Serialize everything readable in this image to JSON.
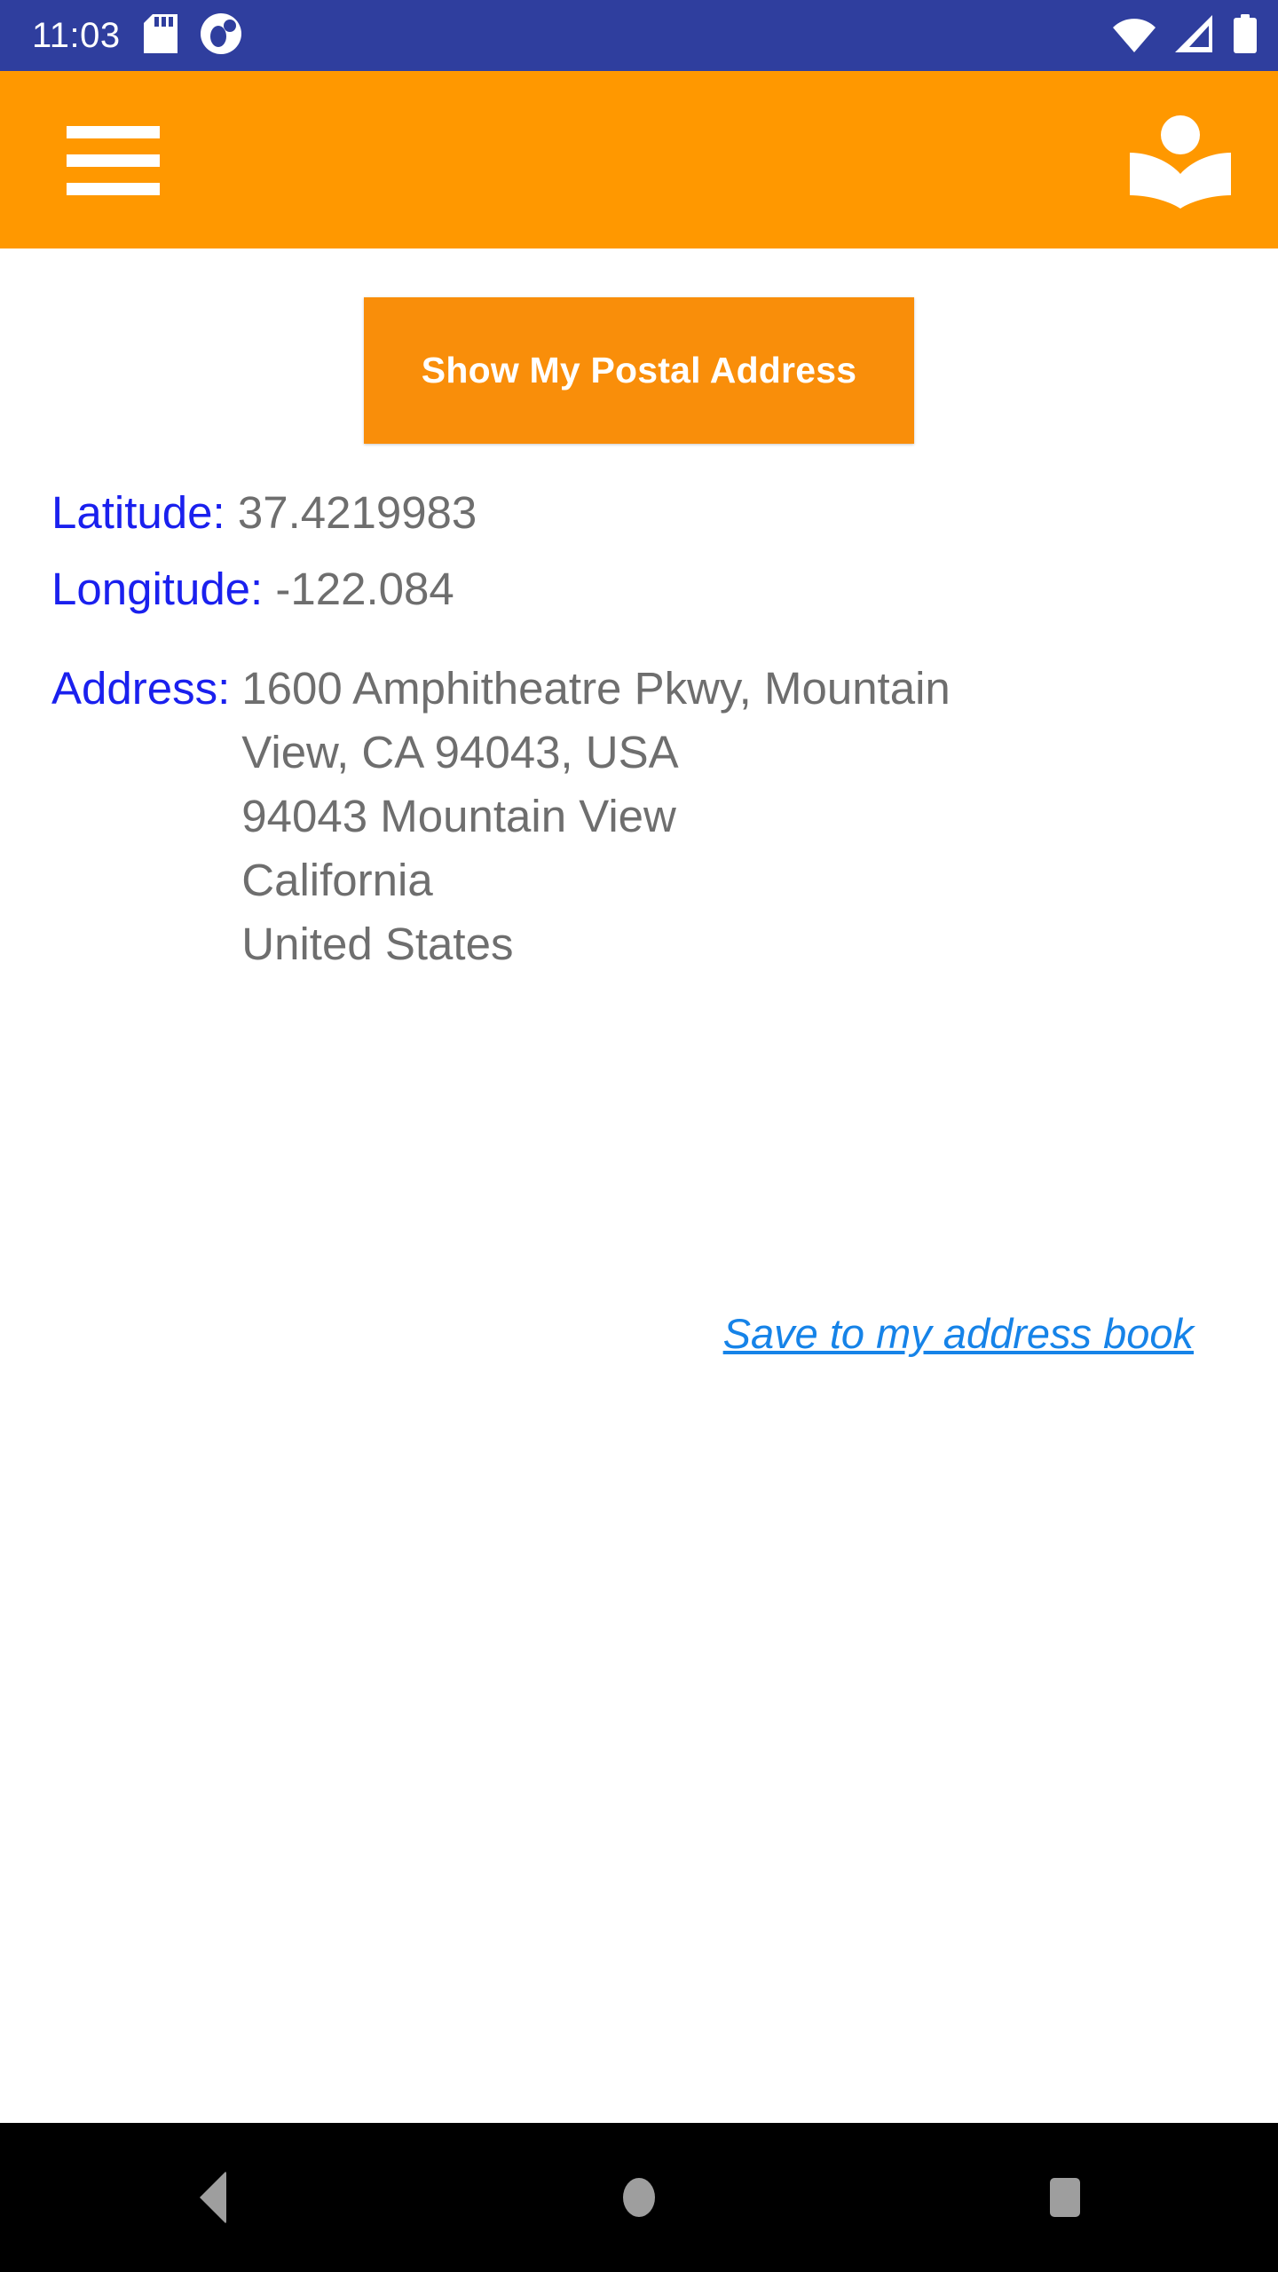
{
  "status_bar": {
    "time": "11:03",
    "background_color": "#2F3E9E",
    "left_icons": [
      "sd-card-icon",
      "app-notification-icon"
    ],
    "right_icons": [
      "wifi-icon",
      "cellular-signal-icon",
      "battery-icon"
    ]
  },
  "app_bar": {
    "background_color": "#FF9800",
    "menu_icon": "hamburger-menu-icon",
    "action_icon": "address-book-icon"
  },
  "main": {
    "show_address_button": {
      "label": "Show My Postal Address",
      "color": "#F98E0A",
      "text_color": "#FFFFFF"
    },
    "label_color": "#1A20EE",
    "value_color": "#6E6E6E",
    "latitude": {
      "label": "Latitude:",
      "value": "37.4219983"
    },
    "longitude": {
      "label": "Longitude:",
      "value": "-122.084"
    },
    "address": {
      "label": "Address:",
      "lines": [
        "1600 Amphitheatre Pkwy, Mountain",
        "View, CA 94043, USA",
        "94043 Mountain View",
        "California",
        "United States"
      ]
    },
    "save_link": {
      "label": "Save to my address book",
      "color": "#1683E8"
    }
  },
  "nav_bar": {
    "background_color": "#000000",
    "glyph_color": "#9E9E9E",
    "buttons": [
      "back-button",
      "home-button",
      "recents-button"
    ]
  }
}
